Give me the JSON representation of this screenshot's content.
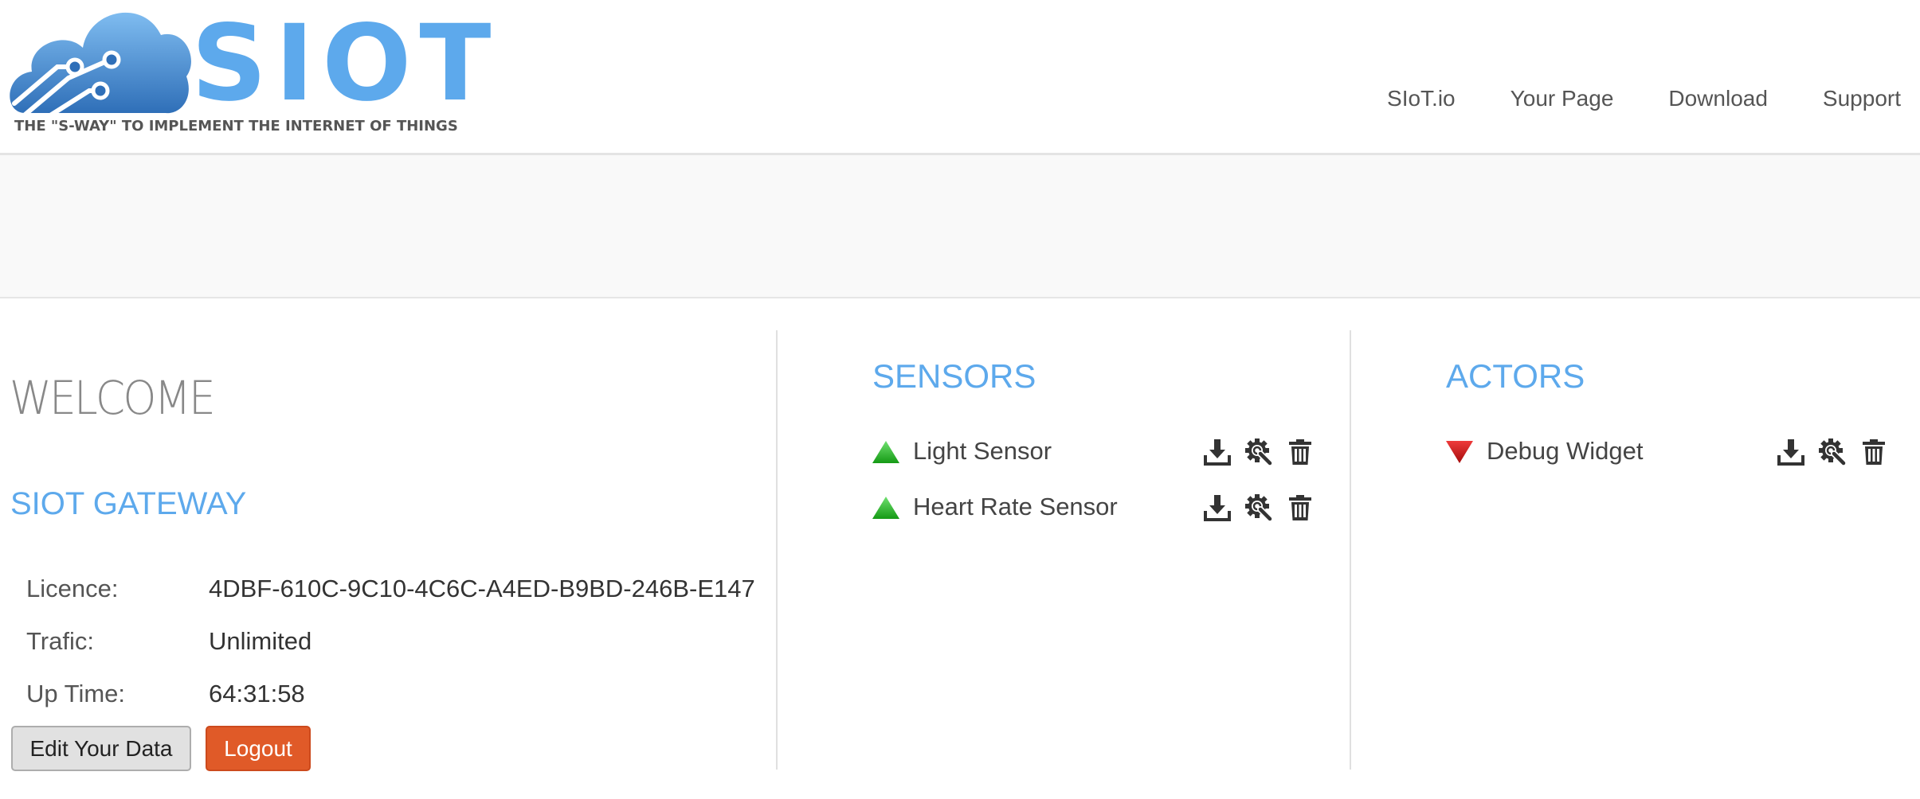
{
  "logo": {
    "word": "SIOT",
    "tagline": "THE \"S-WAY\" TO IMPLEMENT THE INTERNET OF THINGS"
  },
  "nav": {
    "items": [
      {
        "label": "SIoT.io"
      },
      {
        "label": "Your Page"
      },
      {
        "label": "Download"
      },
      {
        "label": "Support"
      }
    ]
  },
  "welcome": {
    "title": "WELCOME",
    "gateway_title": "SIOT GATEWAY",
    "info": {
      "licence": {
        "label": "Licence:",
        "value": "4DBF-610C-9C10-4C6C-A4ED-B9BD-246B-E147"
      },
      "traffic": {
        "label": "Trafic:",
        "value": "Unlimited"
      },
      "uptime": {
        "label": "Up Time:",
        "value": "64:31:58"
      }
    },
    "edit_button": "Edit Your Data",
    "logout_button": "Logout"
  },
  "sensors": {
    "title": "SENSORS",
    "items": [
      {
        "label": "Light Sensor",
        "status": "up"
      },
      {
        "label": "Heart Rate Sensor",
        "status": "up"
      }
    ]
  },
  "actors": {
    "title": "ACTORS",
    "items": [
      {
        "label": "Debug Widget",
        "status": "down"
      }
    ]
  },
  "icons": {
    "status_up": "green-triangle-up-icon",
    "status_down": "red-triangle-down-icon",
    "download": "download-icon",
    "settings": "gear-search-icon",
    "delete": "trash-icon"
  },
  "colors": {
    "accent": "#5da9ec",
    "logout": "#e05a28",
    "status_up": "#2cb52c",
    "status_down": "#d41818"
  }
}
